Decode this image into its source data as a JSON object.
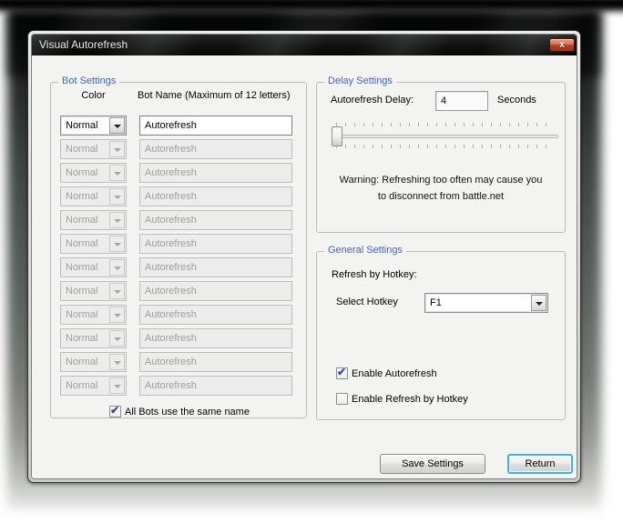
{
  "window": {
    "title": "Visual Autorefresh"
  },
  "icons": {
    "close": "x",
    "check": "✔"
  },
  "bot_settings": {
    "legend": "Bot Settings",
    "color_header": "Color",
    "name_header": "Bot Name (Maximum of 12 letters)",
    "rows": [
      {
        "color": "Normal",
        "name": "Autorefresh",
        "enabled": true
      },
      {
        "color": "Normal",
        "name": "Autorefresh",
        "enabled": false
      },
      {
        "color": "Normal",
        "name": "Autorefresh",
        "enabled": false
      },
      {
        "color": "Normal",
        "name": "Autorefresh",
        "enabled": false
      },
      {
        "color": "Normal",
        "name": "Autorefresh",
        "enabled": false
      },
      {
        "color": "Normal",
        "name": "Autorefresh",
        "enabled": false
      },
      {
        "color": "Normal",
        "name": "Autorefresh",
        "enabled": false
      },
      {
        "color": "Normal",
        "name": "Autorefresh",
        "enabled": false
      },
      {
        "color": "Normal",
        "name": "Autorefresh",
        "enabled": false
      },
      {
        "color": "Normal",
        "name": "Autorefresh",
        "enabled": false
      },
      {
        "color": "Normal",
        "name": "Autorefresh",
        "enabled": false
      },
      {
        "color": "Normal",
        "name": "Autorefresh",
        "enabled": false
      }
    ],
    "all_bots_checkbox": {
      "label": "All Bots use the same name",
      "checked": true
    }
  },
  "delay_settings": {
    "legend": "Delay Settings",
    "delay_label": "Autorefresh Delay:",
    "delay_value": "4",
    "unit_label": "Seconds",
    "warning_line1": "Warning: Refreshing too often may cause you",
    "warning_line2": "to disconnect from battle.net"
  },
  "general_settings": {
    "legend": "General Settings",
    "section_label": "Refresh by Hotkey:",
    "select_hotkey_label": "Select Hotkey",
    "hotkey_value": "F1",
    "enable_autorefresh": {
      "label": "Enable Autorefresh",
      "checked": true
    },
    "enable_hotkey": {
      "label": "Enable Refresh by Hotkey",
      "checked": false
    }
  },
  "footer": {
    "save_label": "Save Settings",
    "return_label": "Return"
  },
  "colors": {
    "group_label_blue": "#4462c8",
    "close_button_red": "#b04028",
    "default_button_focus": "#3fb2e5"
  }
}
